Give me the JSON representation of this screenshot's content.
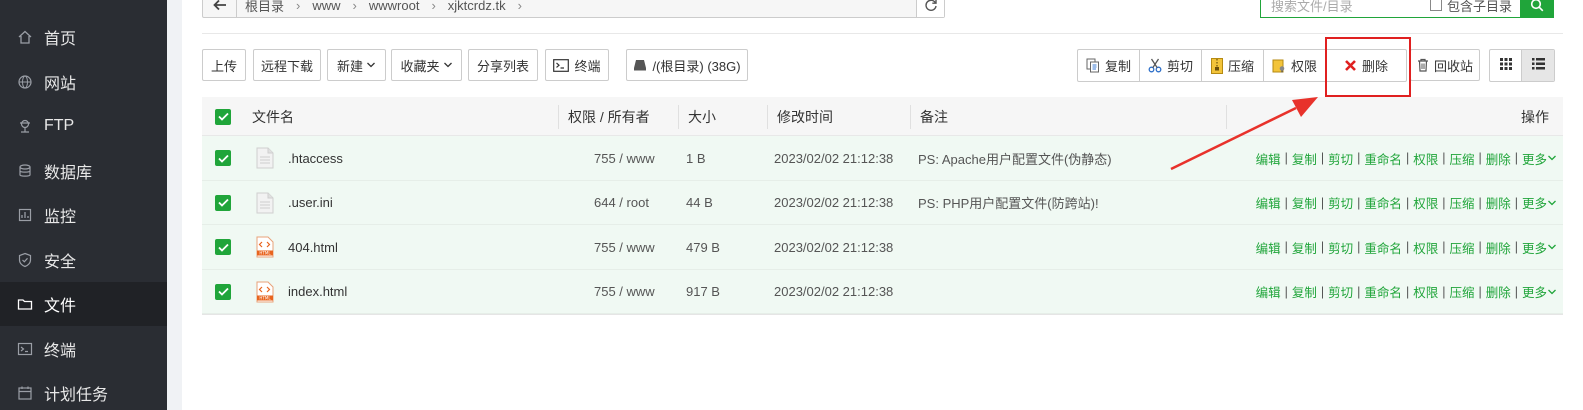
{
  "sidebar": {
    "items": [
      {
        "label": "首页",
        "icon": "home-icon"
      },
      {
        "label": "网站",
        "icon": "globe-icon"
      },
      {
        "label": "FTP",
        "icon": "ftp-icon"
      },
      {
        "label": "数据库",
        "icon": "database-icon"
      },
      {
        "label": "监控",
        "icon": "monitor-icon"
      },
      {
        "label": "安全",
        "icon": "shield-icon"
      },
      {
        "label": "文件",
        "icon": "folder-icon",
        "active": true
      },
      {
        "label": "终端",
        "icon": "terminal-icon"
      },
      {
        "label": "计划任务",
        "icon": "clock-icon"
      }
    ]
  },
  "path": {
    "crumbs": [
      "根目录",
      "www",
      "wwwroot",
      "xjktcrdz.tk"
    ]
  },
  "search": {
    "placeholder": "搜索文件/目录",
    "subdir_label": "包含子目录"
  },
  "toolbar": {
    "upload": "上传",
    "remote_download": "远程下载",
    "new": "新建",
    "favorites": "收藏夹",
    "share_list": "分享列表",
    "terminal": "终端",
    "disk": "/(根目录) (38G)",
    "copy": "复制",
    "cut": "剪切",
    "compress": "压缩",
    "permission": "权限",
    "delete": "删除",
    "recycle": "回收站"
  },
  "table": {
    "headers": {
      "name": "文件名",
      "perm": "权限 / 所有者",
      "size": "大小",
      "mtime": "修改时间",
      "note": "备注",
      "ops": "操作"
    },
    "rows": [
      {
        "name": ".htaccess",
        "type": "text",
        "perm": "755 / www",
        "size": "1 B",
        "mtime": "2023/02/02 21:12:38",
        "note": "PS: Apache用户配置文件(伪静态)"
      },
      {
        "name": ".user.ini",
        "type": "text",
        "perm": "644 / root",
        "size": "44 B",
        "mtime": "2023/02/02 21:12:38",
        "note": "PS: PHP用户配置文件(防跨站)!"
      },
      {
        "name": "404.html",
        "type": "html",
        "perm": "755 / www",
        "size": "479 B",
        "mtime": "2023/02/02 21:12:38",
        "note": ""
      },
      {
        "name": "index.html",
        "type": "html",
        "perm": "755 / www",
        "size": "917 B",
        "mtime": "2023/02/02 21:12:38",
        "note": ""
      }
    ],
    "ops": [
      "编辑",
      "复制",
      "剪切",
      "重命名",
      "权限",
      "压缩",
      "删除",
      "更多"
    ]
  },
  "colors": {
    "accent": "#20a53a",
    "sidebar_bg": "#2a2d33",
    "annotation": "#e02020"
  }
}
